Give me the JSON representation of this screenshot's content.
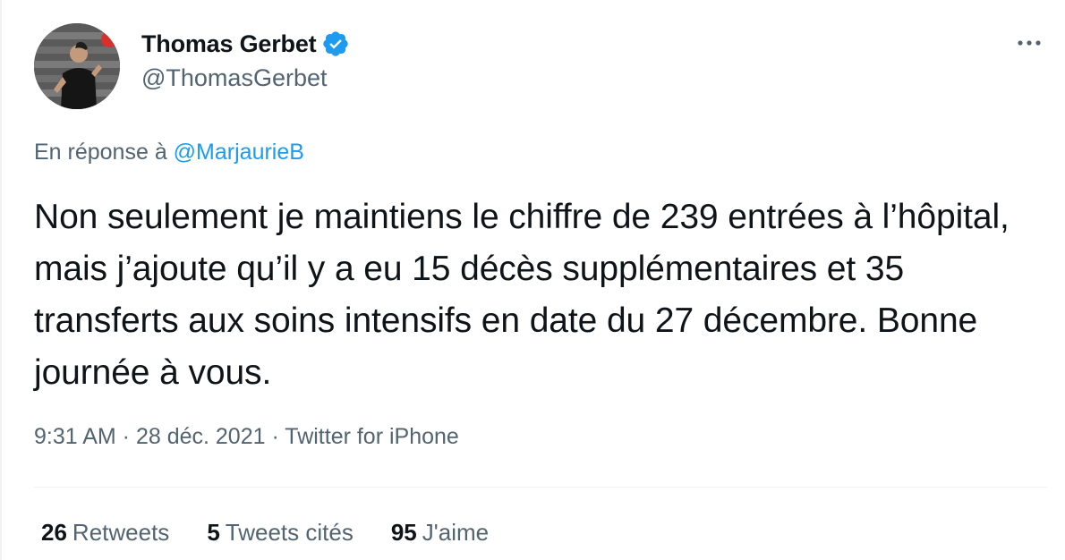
{
  "author": {
    "display_name": "Thomas Gerbet",
    "handle": "@ThomasGerbet",
    "verified_icon": "verified-badge-icon",
    "avatar_icon": "profile-photo"
  },
  "reply": {
    "prefix": "En réponse à",
    "mention": "@MarjaurieB"
  },
  "tweet": {
    "text": "Non seulement je maintiens le chiffre de 239 entrées à l’hôpital, mais j’ajoute qu’il y a eu 15 décès supplémentaires et 35 transferts aux soins intensifs en date du 27 décembre. Bonne journée à vous."
  },
  "meta": {
    "time": "9:31 AM",
    "separator": " · ",
    "date": "28 déc. 2021",
    "source": "Twitter for iPhone"
  },
  "stats": {
    "retweets_count": "26",
    "retweets_label": "Retweets",
    "quotes_count": "5",
    "quotes_label": "Tweets cités",
    "likes_count": "95",
    "likes_label": "J'aime"
  },
  "colors": {
    "text": "#0f1419",
    "secondary": "#536471",
    "accent": "#1d9bf0",
    "divider": "#eff3f4"
  }
}
